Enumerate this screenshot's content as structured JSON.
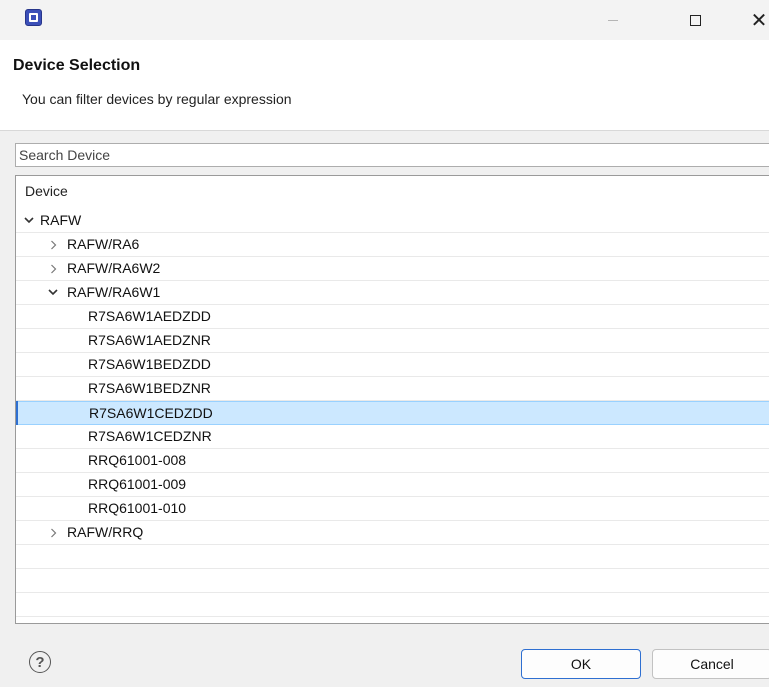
{
  "window": {
    "app_icon": "eclipse-app-icon",
    "minimize_glyph": "—",
    "maximize_glyph": "☐",
    "close_glyph": "✕"
  },
  "header": {
    "title": "Device Selection",
    "description": "You can filter devices by regular expression"
  },
  "search": {
    "placeholder": "Search Device",
    "value": ""
  },
  "tree": {
    "column_header": "Device",
    "rows": [
      {
        "label": "RAFW",
        "level": 0,
        "toggle": "expanded"
      },
      {
        "label": "RAFW/RA6",
        "level": 1,
        "toggle": "collapsed"
      },
      {
        "label": "RAFW/RA6W2",
        "level": 1,
        "toggle": "collapsed"
      },
      {
        "label": "RAFW/RA6W1",
        "level": 1,
        "toggle": "expanded"
      },
      {
        "label": "R7SA6W1AEDZDD",
        "level": 2,
        "toggle": "none"
      },
      {
        "label": "R7SA6W1AEDZNR",
        "level": 2,
        "toggle": "none"
      },
      {
        "label": "R7SA6W1BEDZDD",
        "level": 2,
        "toggle": "none"
      },
      {
        "label": "R7SA6W1BEDZNR",
        "level": 2,
        "toggle": "none"
      },
      {
        "label": "R7SA6W1CEDZDD",
        "level": 2,
        "toggle": "none",
        "selected": true
      },
      {
        "label": "R7SA6W1CEDZNR",
        "level": 2,
        "toggle": "none"
      },
      {
        "label": "RRQ61001-008",
        "level": 2,
        "toggle": "none"
      },
      {
        "label": "RRQ61001-009",
        "level": 2,
        "toggle": "none"
      },
      {
        "label": "RRQ61001-010",
        "level": 2,
        "toggle": "none"
      },
      {
        "label": "RAFW/RRQ",
        "level": 1,
        "toggle": "collapsed"
      }
    ],
    "selection_color": "#cce8ff"
  },
  "footer": {
    "help_glyph": "?",
    "ok_label": "OK",
    "cancel_label": "Cancel"
  },
  "colors": {
    "accent": "#2e6fd1",
    "dialog_bg": "#f0f0f0"
  }
}
